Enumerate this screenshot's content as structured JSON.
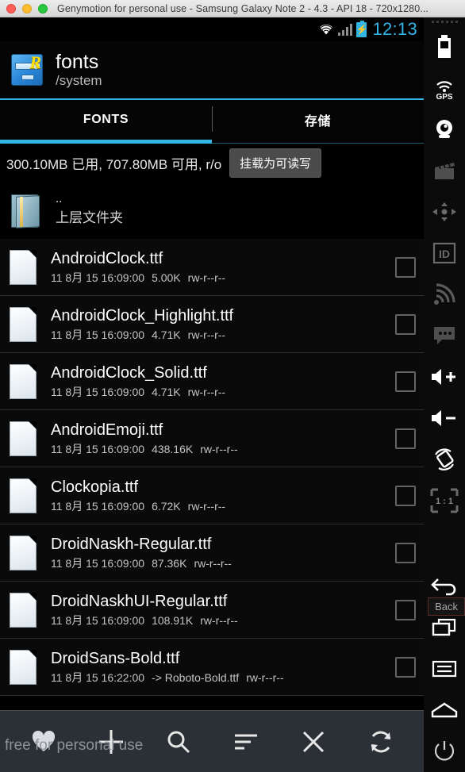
{
  "window": {
    "title": "Genymotion for personal use - Samsung Galaxy Note 2 - 4.3 - API 18 - 720x1280...",
    "traffic_lights": [
      "close",
      "minimize",
      "maximize"
    ]
  },
  "statusbar": {
    "time": "12:13",
    "icons": [
      "wifi-icon",
      "signal-icon",
      "battery-charging-icon"
    ],
    "accent_color": "#33b5e5"
  },
  "app_header": {
    "icon": "root-explorer-icon",
    "title": "fonts",
    "path": "/system"
  },
  "tabs": [
    {
      "label": "FONTS",
      "active": true
    },
    {
      "label": "存储",
      "active": false
    }
  ],
  "storage": {
    "info": "300.10MB 已用, 707.80MB 可用, r/o",
    "mount_button": "挂载为可读写"
  },
  "parent_entry": {
    "dots": "..",
    "label": "上层文件夹",
    "icon": "folder-icon"
  },
  "files": [
    {
      "name": "AndroidClock.ttf",
      "date": "11 8月 15 16:09:00",
      "size": "5.00K",
      "perms": "rw-r--r--",
      "checked": false
    },
    {
      "name": "AndroidClock_Highlight.ttf",
      "date": "11 8月 15 16:09:00",
      "size": "4.71K",
      "perms": "rw-r--r--",
      "checked": false
    },
    {
      "name": "AndroidClock_Solid.ttf",
      "date": "11 8月 15 16:09:00",
      "size": "4.71K",
      "perms": "rw-r--r--",
      "checked": false
    },
    {
      "name": "AndroidEmoji.ttf",
      "date": "11 8月 15 16:09:00",
      "size": "438.16K",
      "perms": "rw-r--r--",
      "checked": false
    },
    {
      "name": "Clockopia.ttf",
      "date": "11 8月 15 16:09:00",
      "size": "6.72K",
      "perms": "rw-r--r--",
      "checked": false
    },
    {
      "name": "DroidNaskh-Regular.ttf",
      "date": "11 8月 15 16:09:00",
      "size": "87.36K",
      "perms": "rw-r--r--",
      "checked": false
    },
    {
      "name": "DroidNaskhUI-Regular.ttf",
      "date": "11 8月 15 16:09:00",
      "size": "108.91K",
      "perms": "rw-r--r--",
      "checked": false
    },
    {
      "name": "DroidSans-Bold.ttf",
      "date": "11 8月 15 16:22:00",
      "size": "-> Roboto-Bold.ttf",
      "perms": "rw-r--r--",
      "checked": false
    }
  ],
  "bottom_toolbar": [
    {
      "name": "favorite-heart-icon"
    },
    {
      "name": "add-plus-icon"
    },
    {
      "name": "search-icon"
    },
    {
      "name": "sort-icon"
    },
    {
      "name": "close-x-icon"
    },
    {
      "name": "refresh-icon"
    }
  ],
  "watermark": "free for personal use",
  "sidebar": {
    "items": [
      {
        "name": "battery-icon",
        "label": ""
      },
      {
        "name": "gps-icon",
        "label": "GPS"
      },
      {
        "name": "camera-icon",
        "label": ""
      },
      {
        "name": "video-capture-icon",
        "label": ""
      },
      {
        "name": "dpad-icon",
        "label": ""
      },
      {
        "name": "identifiers-icon",
        "label": "ID"
      },
      {
        "name": "network-icon",
        "label": ""
      },
      {
        "name": "sms-icon",
        "label": ""
      },
      {
        "name": "volume-up-icon",
        "label": ""
      },
      {
        "name": "volume-down-icon",
        "label": ""
      },
      {
        "name": "rotate-icon",
        "label": ""
      },
      {
        "name": "zoom-ratio-icon",
        "label": "1 : 1"
      },
      {
        "name": "back-icon",
        "label": ""
      },
      {
        "name": "recents-icon",
        "label": ""
      },
      {
        "name": "menu-icon",
        "label": ""
      },
      {
        "name": "home-icon",
        "label": ""
      },
      {
        "name": "power-icon",
        "label": ""
      }
    ],
    "tooltip": "Back"
  }
}
